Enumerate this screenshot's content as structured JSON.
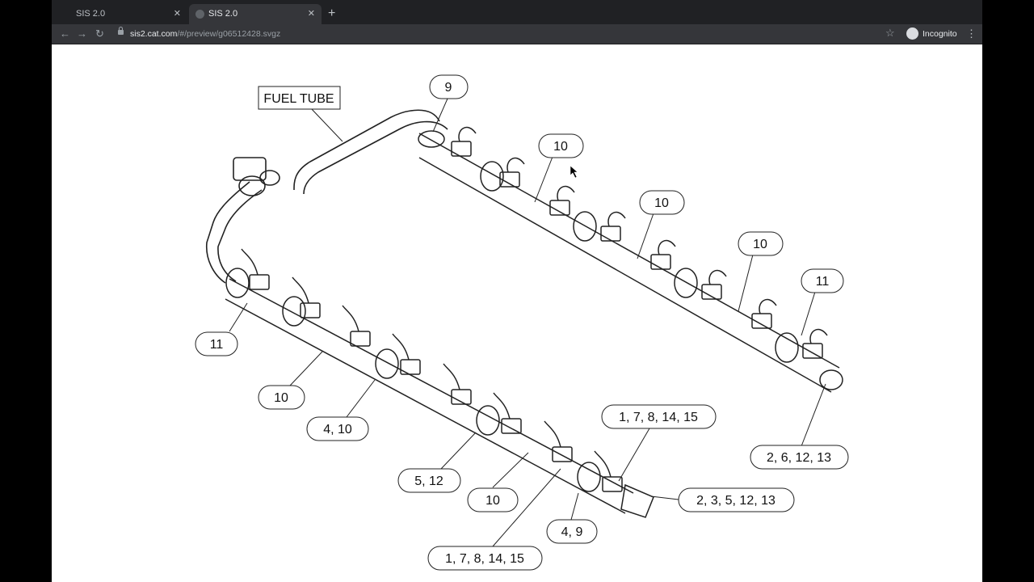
{
  "browser": {
    "tabs": [
      {
        "title": "SIS 2.0",
        "active": false
      },
      {
        "title": "SIS 2.0",
        "active": true
      }
    ],
    "url_host": "sis2.cat.com",
    "url_rest": "/#/preview/g06512428.svgz",
    "profile_label": "Incognito"
  },
  "diagram": {
    "fuel_tube_label": "FUEL TUBE",
    "callouts": {
      "c9": "9",
      "c10_top1": "10",
      "c10_top2": "10",
      "c10_top3": "10",
      "c11_top": "11",
      "c2_6_12_13": "2, 6, 12, 13",
      "c11_left": "11",
      "c10_left": "10",
      "c4_10": "4, 10",
      "c5_12": "5, 12",
      "c10_bottom": "10",
      "c4_9": "4, 9",
      "c1_7_8_14_15_top": "1, 7, 8, 14, 15",
      "c1_7_8_14_15_bottom": "1, 7, 8, 14, 15",
      "c2_3_5_12_13": "2, 3, 5, 12, 13"
    }
  }
}
